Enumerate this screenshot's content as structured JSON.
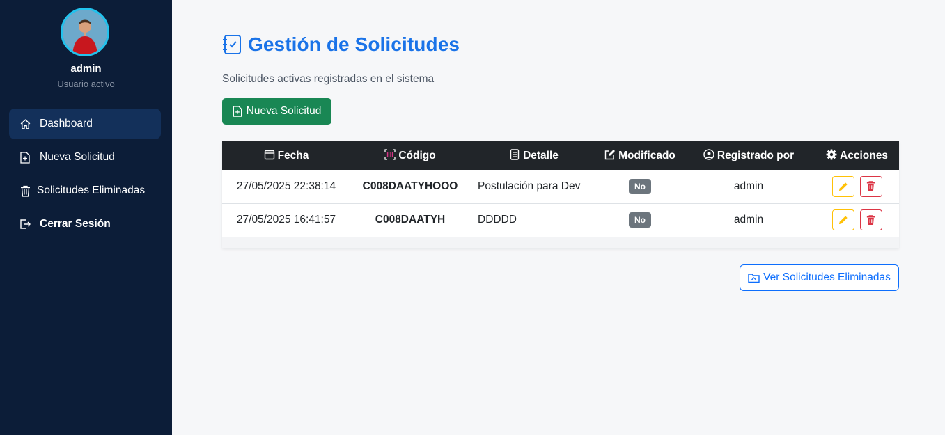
{
  "user": {
    "name": "admin",
    "status": "Usuario activo"
  },
  "nav": [
    {
      "label": "Dashboard",
      "icon": "home-icon"
    },
    {
      "label": "Nueva Solicitud",
      "icon": "file-plus-icon"
    },
    {
      "label": "Solicitudes Eliminadas",
      "icon": "trash-icon"
    },
    {
      "label": "Cerrar Sesión",
      "icon": "logout-icon"
    }
  ],
  "page": {
    "title": "Gestión de Solicitudes",
    "subtitle": "Solicitudes activas registradas en el sistema",
    "new_button": "Nueva Solicitud",
    "deleted_button": "Ver Solicitudes Eliminadas"
  },
  "table": {
    "headers": [
      "Fecha",
      "Código",
      "Detalle",
      "Modificado",
      "Registrado por",
      "Acciones"
    ],
    "rows": [
      {
        "fecha": "27/05/2025 22:38:14",
        "codigo": "C008DAATYHOOO",
        "detalle": "Postulación para Dev",
        "modificado": "No",
        "registrado": "admin"
      },
      {
        "fecha": "27/05/2025 16:41:57",
        "codigo": "C008DAATYH",
        "detalle": "DDDDD",
        "modificado": "No",
        "registrado": "admin"
      }
    ]
  },
  "colors": {
    "sidebar": "#0c1d38",
    "accent": "#1a73e8",
    "success": "#198754",
    "warning": "#ffc107",
    "danger": "#dc3545"
  }
}
